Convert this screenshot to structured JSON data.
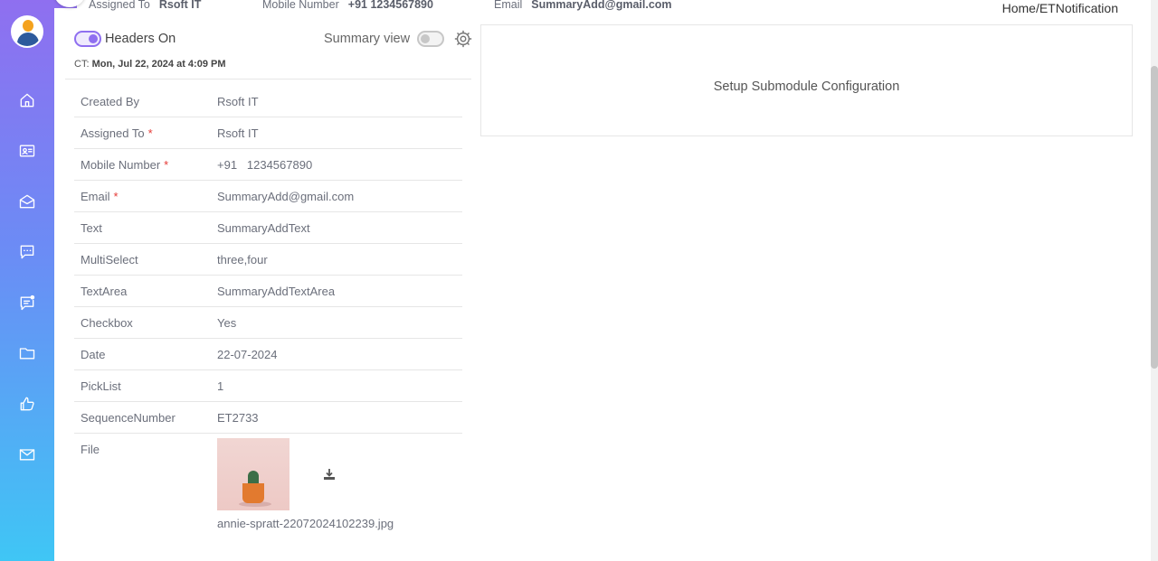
{
  "header": {
    "assigned_to_label": "Assigned To",
    "assigned_to_value": "Rsoft  IT",
    "mobile_label": "Mobile Number",
    "mobile_value": "+91 1234567890",
    "email_label": "Email",
    "email_value": "SummaryAdd@gmail.com"
  },
  "breadcrumb": "Home/ETNotification",
  "controls": {
    "headers_toggle_label": "Headers On",
    "summary_view_label": "Summary view",
    "ct_prefix": "CT:",
    "ct_value": "Mon, Jul 22, 2024 at 4:09 PM"
  },
  "details": [
    {
      "label": "Created By",
      "required": "",
      "value": "Rsoft IT"
    },
    {
      "label": "Assigned To",
      "required": "*",
      "value": "Rsoft IT"
    },
    {
      "label": "Mobile Number",
      "required": "*",
      "value": "+91   1234567890"
    },
    {
      "label": "Email",
      "required": "*",
      "value": "SummaryAdd@gmail.com"
    },
    {
      "label": "Text",
      "required": "",
      "value": "SummaryAddText"
    },
    {
      "label": "MultiSelect",
      "required": "",
      "value": "three,four"
    },
    {
      "label": "TextArea",
      "required": "",
      "value": "SummaryAddTextArea"
    },
    {
      "label": "Checkbox",
      "required": "",
      "value": "Yes"
    },
    {
      "label": "Date",
      "required": "",
      "value": "22-07-2024"
    },
    {
      "label": "PickList",
      "required": "",
      "value": "1"
    },
    {
      "label": "SequenceNumber",
      "required": "",
      "value": "ET2733"
    }
  ],
  "file": {
    "label": "File",
    "filename": "annie-spratt-22072024102239.jpg"
  },
  "right_panel": {
    "message": "Setup Submodule Configuration"
  },
  "sidebar": {
    "icons": [
      "home-icon",
      "contact-card-icon",
      "mail-open-icon",
      "chat-icon",
      "notification-chat-icon",
      "folder-icon",
      "thumbs-up-icon",
      "mail-icon"
    ]
  },
  "colors": {
    "accent": "#8f6ff0",
    "sidebar_bottom": "#3fc6f5",
    "required": "#e53935"
  }
}
